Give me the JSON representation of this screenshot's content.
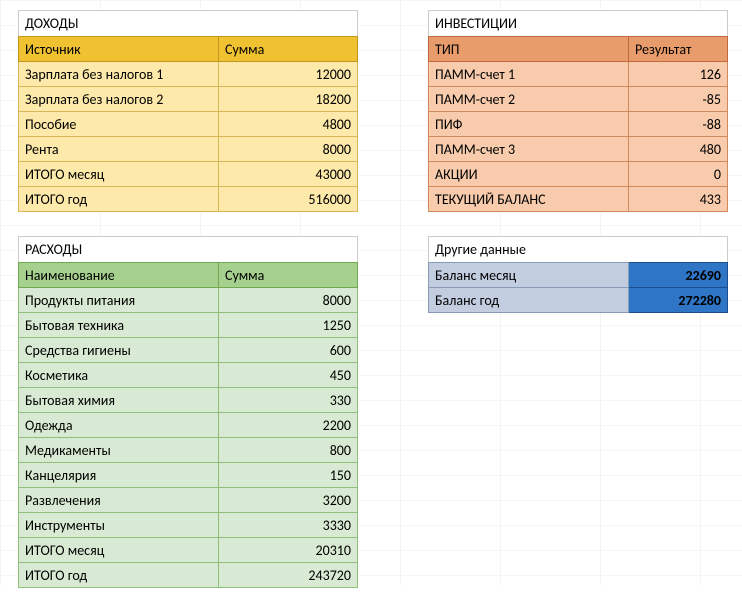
{
  "income": {
    "title": "ДОХОДЫ",
    "headers": [
      "Источник",
      "Сумма"
    ],
    "rows": [
      [
        "Зарплата без налогов 1",
        "12000"
      ],
      [
        "Зарплата без налогов 2",
        "18200"
      ],
      [
        "Пособие",
        "4800"
      ],
      [
        "Рента",
        "8000"
      ],
      [
        "ИТОГО месяц",
        "43000"
      ],
      [
        "ИТОГО год",
        "516000"
      ]
    ]
  },
  "expenses": {
    "title": "РАСХОДЫ",
    "headers": [
      "Наименование",
      "Сумма"
    ],
    "rows": [
      [
        "Продукты питания",
        "8000"
      ],
      [
        "Бытовая техника",
        "1250"
      ],
      [
        "Средства гигиены",
        "600"
      ],
      [
        "Косметика",
        "450"
      ],
      [
        "Бытовая химия",
        "330"
      ],
      [
        "Одежда",
        "2200"
      ],
      [
        "Медикаменты",
        "800"
      ],
      [
        "Канцелярия",
        "150"
      ],
      [
        "Развлечения",
        "3200"
      ],
      [
        "Инструменты",
        "3330"
      ],
      [
        "ИТОГО месяц",
        "20310"
      ],
      [
        "ИТОГО год",
        "243720"
      ]
    ]
  },
  "invest": {
    "title": "ИНВЕСТИЦИИ",
    "headers": [
      "ТИП",
      "Результат"
    ],
    "rows": [
      [
        "ПАММ-счет 1",
        "126"
      ],
      [
        "ПАММ-счет 2",
        "-85"
      ],
      [
        "ПИФ",
        "-88"
      ],
      [
        "ПАММ-счет 3",
        "480"
      ],
      [
        "АКЦИИ",
        "0"
      ],
      [
        "ТЕКУЩИЙ БАЛАНС",
        "433"
      ]
    ]
  },
  "other": {
    "title": "Другие данные",
    "rows": [
      [
        "Баланс месяц",
        "22690"
      ],
      [
        "Баланс год",
        "272280"
      ]
    ]
  }
}
